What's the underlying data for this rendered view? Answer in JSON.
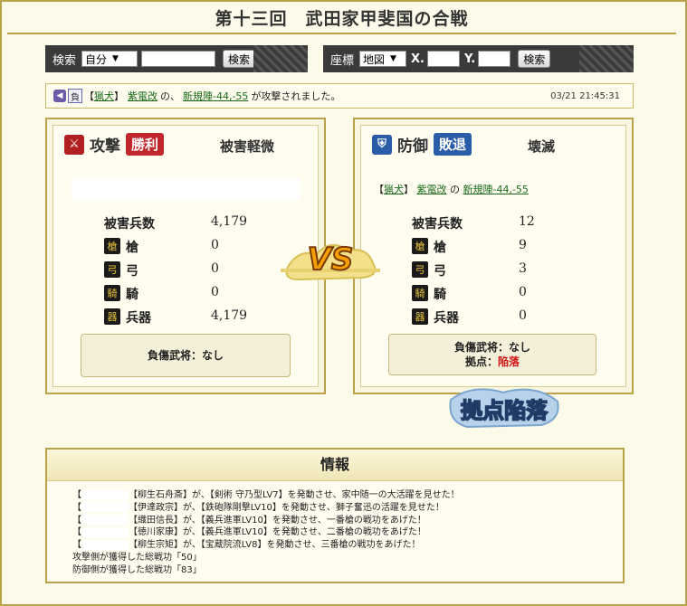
{
  "page": {
    "title": "第十三回　武田家甲斐国の合戦"
  },
  "search_bar": {
    "label": "検索",
    "select_value": "自分",
    "input_value": "",
    "button_label": "検索"
  },
  "coord_bar": {
    "label": "座標",
    "select_value": "地図",
    "x_label": "X.",
    "x_value": "",
    "y_label": "Y.",
    "y_value": "",
    "button_label": "検索"
  },
  "notice": {
    "result_badge": "負",
    "text_open": "【",
    "player": "猟犬",
    "text_close": "】",
    "target": "紫電改",
    "text_of": "の、",
    "location": "新規陣-44,-55",
    "text_suffix": "が攻撃されました。",
    "timestamp": "03/21 21:45:31"
  },
  "attack": {
    "heading": "攻撃",
    "result": "勝利",
    "damage_label": "被害軽微",
    "rows": [
      {
        "label": "被害兵数",
        "value": "4,179"
      },
      {
        "label": "槍",
        "value": "0"
      },
      {
        "label": "弓",
        "value": "0"
      },
      {
        "label": "騎",
        "value": "0"
      },
      {
        "label": "兵器",
        "value": "4,179"
      }
    ],
    "injured": "負傷武将：なし"
  },
  "defense": {
    "heading": "防御",
    "result": "敗退",
    "damage_label": "壊滅",
    "link_open": "【",
    "link_player": "猟犬",
    "link_close": "】",
    "link_target": "紫電改",
    "link_of": "の",
    "link_location": "新規陣-44,-55",
    "rows": [
      {
        "label": "被害兵数",
        "value": "12"
      },
      {
        "label": "槍",
        "value": "9"
      },
      {
        "label": "弓",
        "value": "3"
      },
      {
        "label": "騎",
        "value": "0"
      },
      {
        "label": "兵器",
        "value": "0"
      }
    ],
    "injured": "負傷武将：なし",
    "base_label": "拠点：",
    "base_value": "陥落"
  },
  "vs_text": "VS",
  "fallen_text": "拠点陥落",
  "info": {
    "title": "情報",
    "lines": [
      {
        "pre": "【",
        "post": "【柳生石舟斎】が、【剣術 守乃型LV7】を発動させ、家中随一の大活躍を見せた！"
      },
      {
        "pre": "【",
        "post": "【伊達政宗】が、【鉄砲隊剛撃LV10】を発動させ、獅子奮迅の活躍を見せた！"
      },
      {
        "pre": "【",
        "post": "【織田信長】が、【義兵進軍LV10】を発動させ、一番槍の戦功をあげた！"
      },
      {
        "pre": "【",
        "post": "【徳川家康】が、【義兵進軍LV10】を発動させ、二番槍の戦功をあげた！"
      },
      {
        "pre": "【",
        "post": "【柳生宗矩】が、【宝蔵院流LV8】を発動させ、三番槍の戦功をあげた！"
      }
    ],
    "summary": [
      "攻撃側が獲得した総戦功「50」",
      "防御側が獲得した総戦功「83」"
    ]
  },
  "colors": {
    "gold_border": "#b9a24a",
    "win_red": "#c0282c",
    "lose_blue": "#2a5ca8",
    "link_green": "#1a6a1a"
  }
}
